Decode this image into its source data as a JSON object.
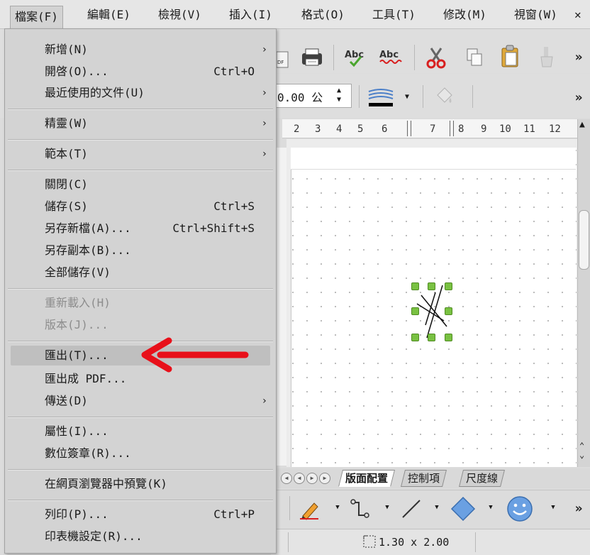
{
  "menubar": {
    "file": "檔案(F)",
    "edit": "編輯(E)",
    "view": "檢視(V)",
    "insert": "插入(I)",
    "format": "格式(O)",
    "tools": "工具(T)",
    "modify": "修改(M)",
    "window": "視窗(W)",
    "close": "✕"
  },
  "file_menu": {
    "new": {
      "label": "新增(N)",
      "submenu": "›"
    },
    "open": {
      "label": "開啓(O)...",
      "shortcut": "Ctrl+O"
    },
    "recent": {
      "label": "最近使用的文件(U)",
      "submenu": "›"
    },
    "wizards": {
      "label": "精靈(W)",
      "submenu": "›"
    },
    "templates": {
      "label": "範本(T)",
      "submenu": "›"
    },
    "close": {
      "label": "關閉(C)"
    },
    "save": {
      "label": "儲存(S)",
      "shortcut": "Ctrl+S"
    },
    "save_as": {
      "label": "另存新檔(A)...",
      "shortcut": "Ctrl+Shift+S"
    },
    "save_copy": {
      "label": "另存副本(B)..."
    },
    "save_all": {
      "label": "全部儲存(V)"
    },
    "reload": {
      "label": "重新載入(H)"
    },
    "versions": {
      "label": "版本(J)..."
    },
    "export": {
      "label": "匯出(T)..."
    },
    "export_pdf": {
      "label": "匯出成 PDF..."
    },
    "send": {
      "label": "傳送(D)",
      "submenu": "›"
    },
    "properties": {
      "label": "屬性(I)..."
    },
    "digital_signatures": {
      "label": "數位簽章(R)..."
    },
    "preview_browser": {
      "label": "在網頁瀏覽器中預覽(K)"
    },
    "print": {
      "label": "列印(P)...",
      "shortcut": "Ctrl+P"
    },
    "printer_settings": {
      "label": "印表機設定(R)..."
    }
  },
  "toolbar": {
    "width_value": "0.00 公",
    "overflow": "»"
  },
  "ruler": {
    "ticks": [
      "2",
      "3",
      "4",
      "5",
      "6",
      "7",
      "8",
      "9",
      "10",
      "11",
      "12"
    ]
  },
  "tabs": {
    "layout": "版面配置",
    "controls": "控制項",
    "dimension_lines": "尺度線"
  },
  "status": {
    "size": "1.30 x 2.00"
  },
  "colors": {
    "annotation_arrow": "#e8101a",
    "handle": "#79c142"
  }
}
